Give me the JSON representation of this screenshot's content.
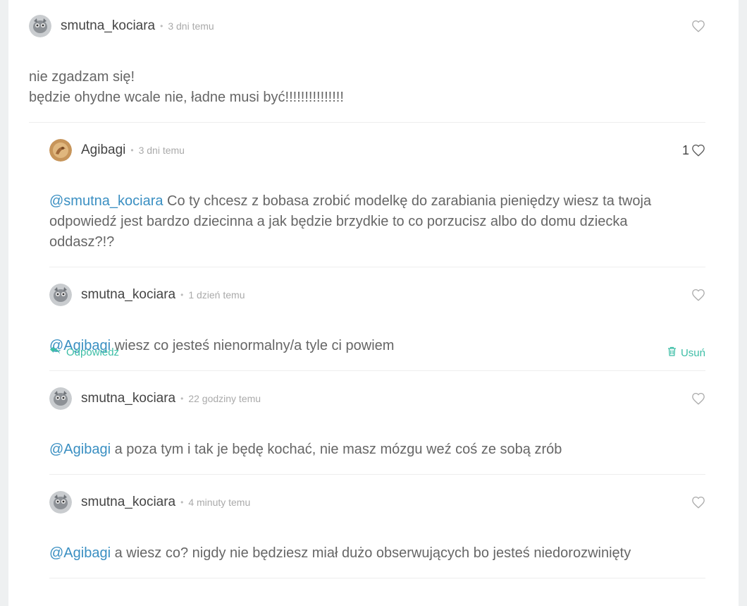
{
  "comments": [
    {
      "author": "smutna_kociara",
      "time": "3 dni temu",
      "body": "nie zgadzam się!\nbędzie ohydne wcale nie, ładne musi być!!!!!!!!!!!!!!!",
      "likes": ""
    },
    {
      "author": "Agibagi",
      "time": "3 dni temu",
      "mention": "@smutna_kociara",
      "body": " Co ty chcesz z bobasa zrobić modelkę do zarabiania pieniędzy wiesz ta twoja odpowiedź jest bardzo dziecinna a jak będzie brzydkie to co porzucisz albo do domu dziecka oddasz?!?",
      "likes": "1"
    },
    {
      "author": "smutna_kociara",
      "time": "1 dzień temu",
      "mention": "@Agibagi",
      "body": " wiesz co jesteś nienormalny/a tyle ci powiem",
      "likes": "",
      "reply_label": "Odpowiedz",
      "delete_label": "Usuń"
    },
    {
      "author": "smutna_kociara",
      "time": "22 godziny temu",
      "mention": "@Agibagi",
      "body": " a poza tym i tak je będę kochać, nie masz mózgu weź coś ze sobą zrób",
      "likes": ""
    },
    {
      "author": "smutna_kociara",
      "time": "4 minuty temu",
      "mention": "@Agibagi",
      "body": " a wiesz co? nigdy nie będziesz miał dużo obserwujących bo jesteś niedorozwinięty",
      "likes": ""
    }
  ],
  "colors": {
    "mention": "#3a8fc2",
    "action": "#3dbea6"
  },
  "icons": {
    "like": "heart-icon",
    "reply": "reply-arrow-icon",
    "delete": "trash-icon"
  }
}
